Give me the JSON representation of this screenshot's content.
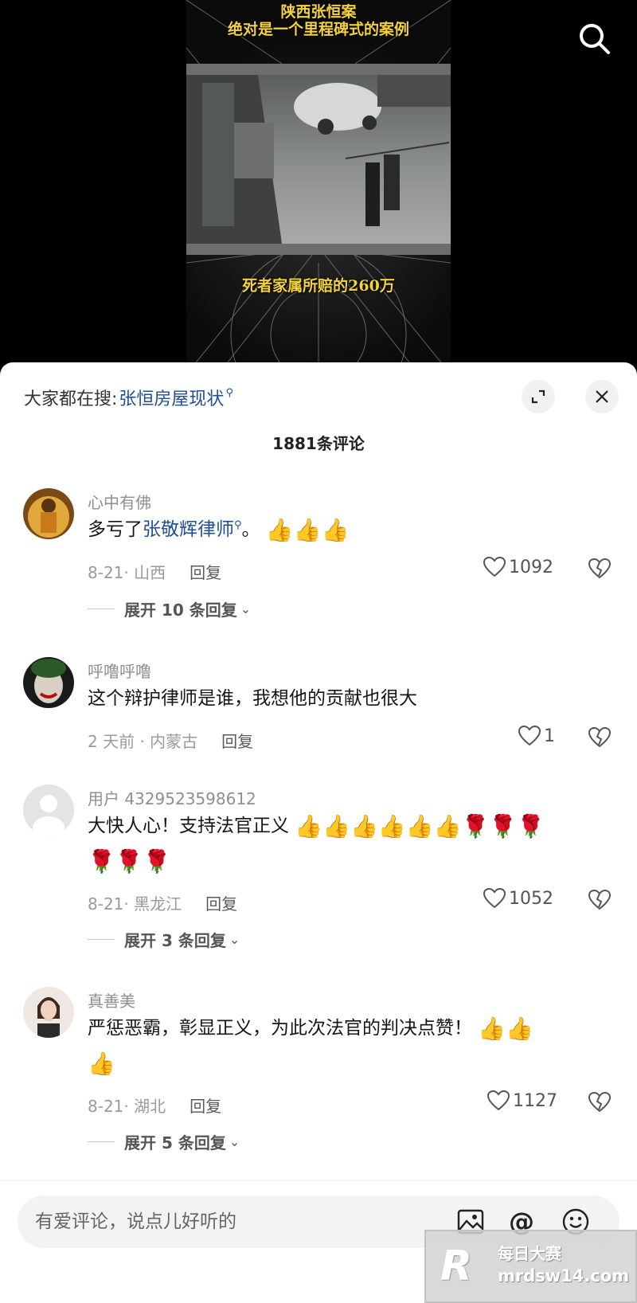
{
  "video": {
    "caption_top_1": "陕西张恒案",
    "caption_top_2": "绝对是一个里程碑式的案例",
    "caption_bottom": "死者家属所赔的260万"
  },
  "sheet": {
    "trending_prefix": "大家都在搜:",
    "trending_query": "张恒房屋现状",
    "comment_count": "1881条评论"
  },
  "comments": [
    {
      "user": "心中有佛",
      "text_before": "多亏了",
      "text_link": "张敬辉律师",
      "text_after": "。",
      "emoji_line1": "👍👍👍",
      "date_loc": "8-21· 山西",
      "reply": "回复",
      "likes": "1092",
      "more_replies": "展开 10 条回复"
    },
    {
      "user": "呼噜呼噜",
      "text": "这个辩护律师是谁，我想他的贡献也很大",
      "date_loc": "2 天前 · 内蒙古",
      "reply": "回复",
      "likes": "1"
    },
    {
      "user": "用户 4329523598612",
      "text": "大快人心！支持法官正义",
      "emoji_line1": "👍👍👍👍👍👍🌹🌹🌹",
      "emoji_line2": "🌹🌹🌹",
      "date_loc": "8-21· 黑龙江",
      "reply": "回复",
      "likes": "1052",
      "more_replies": "展开 3 条回复"
    },
    {
      "user": "真善美",
      "text": "严惩恶霸，彰显正义，为此次法官的判决点赞！",
      "emoji_line1": "👍👍",
      "emoji_line2": "👍",
      "date_loc": "8-21· 湖北",
      "reply": "回复",
      "likes": "1127",
      "more_replies": "展开 5 条回复"
    }
  ],
  "input": {
    "placeholder": "有爱评论，说点儿好听的"
  },
  "watermark": {
    "logo": "R",
    "name": "每日大赛",
    "url": "mrdsw14.com"
  },
  "colors": {
    "link": "#1f4e96",
    "caption": "#f4d23a"
  }
}
